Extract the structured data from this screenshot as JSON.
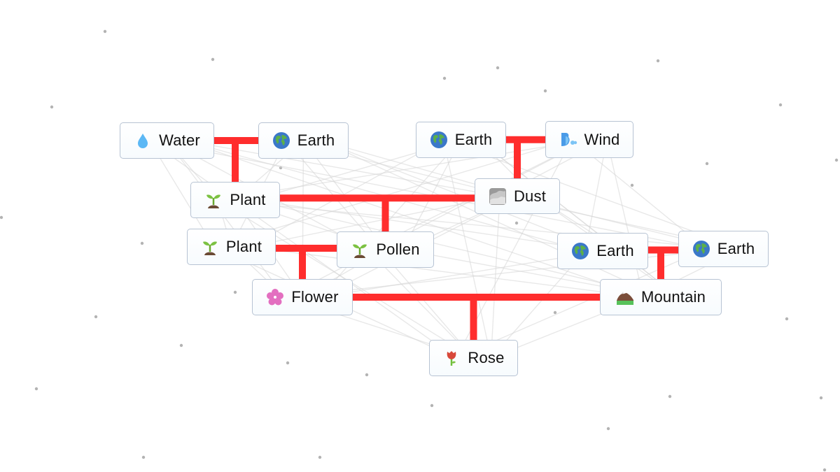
{
  "app": "Infinite Craft recipe tree",
  "colors": {
    "background": "#ffffff",
    "connector": "#ff2d2d",
    "faint_line": "#d6d6d6",
    "node_border": "#b7c3d3",
    "dot": "#9a9a9a"
  },
  "nodes": [
    {
      "id": "water",
      "label": "Water",
      "icon": "water-drop-icon"
    },
    {
      "id": "earth1",
      "label": "Earth",
      "icon": "globe-icon"
    },
    {
      "id": "earth2",
      "label": "Earth",
      "icon": "globe-icon"
    },
    {
      "id": "wind",
      "label": "Wind",
      "icon": "wind-face-icon"
    },
    {
      "id": "plant1",
      "label": "Plant",
      "icon": "seedling-icon"
    },
    {
      "id": "dust",
      "label": "Dust",
      "icon": "dust-fog-icon"
    },
    {
      "id": "plant2",
      "label": "Plant",
      "icon": "seedling-icon"
    },
    {
      "id": "pollen",
      "label": "Pollen",
      "icon": "seedling-icon"
    },
    {
      "id": "earth3",
      "label": "Earth",
      "icon": "globe-icon"
    },
    {
      "id": "earth4",
      "label": "Earth",
      "icon": "globe-icon"
    },
    {
      "id": "flower",
      "label": "Flower",
      "icon": "cherry-blossom-icon"
    },
    {
      "id": "mountain",
      "label": "Mountain",
      "icon": "mountain-icon"
    },
    {
      "id": "rose",
      "label": "Rose",
      "icon": "rose-icon"
    }
  ],
  "recipes": [
    {
      "inputs": [
        "water",
        "earth1"
      ],
      "result": "plant1"
    },
    {
      "inputs": [
        "earth2",
        "wind"
      ],
      "result": "dust"
    },
    {
      "inputs": [
        "plant1",
        "dust"
      ],
      "result": "pollen"
    },
    {
      "inputs": [
        "plant2",
        "pollen"
      ],
      "result": "flower"
    },
    {
      "inputs": [
        "earth3",
        "earth4"
      ],
      "result": "mountain"
    },
    {
      "inputs": [
        "flower",
        "mountain"
      ],
      "result": "rose"
    }
  ]
}
